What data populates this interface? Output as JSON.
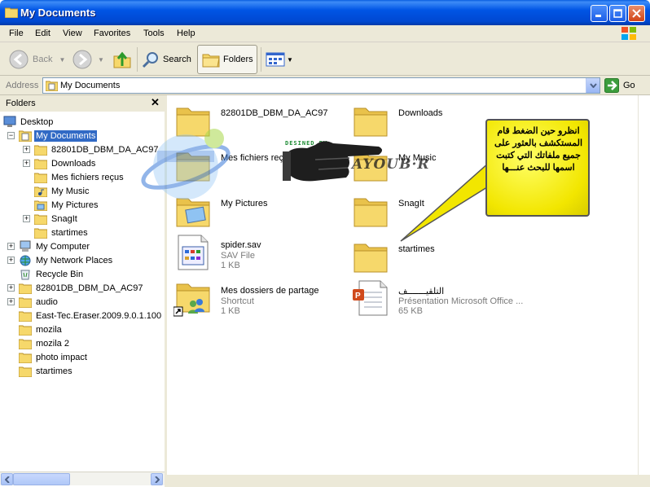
{
  "window": {
    "title": "My Documents"
  },
  "menu": [
    "File",
    "Edit",
    "View",
    "Favorites",
    "Tools",
    "Help"
  ],
  "toolbar": {
    "back": "Back",
    "search": "Search",
    "folders": "Folders"
  },
  "address": {
    "label": "Address",
    "value": "My Documents",
    "go": "Go"
  },
  "folders_pane": {
    "title": "Folders",
    "items": [
      {
        "label": "Desktop"
      },
      {
        "label": "My Documents"
      },
      {
        "label": "82801DB_DBM_DA_AC97"
      },
      {
        "label": "Downloads"
      },
      {
        "label": "Mes fichiers reçus"
      },
      {
        "label": "My Music"
      },
      {
        "label": "My Pictures"
      },
      {
        "label": "SnagIt"
      },
      {
        "label": "startimes"
      },
      {
        "label": "My Computer"
      },
      {
        "label": "My Network Places"
      },
      {
        "label": "Recycle Bin"
      },
      {
        "label": "82801DB_DBM_DA_AC97"
      },
      {
        "label": "audio"
      },
      {
        "label": "East-Tec.Eraser.2009.9.0.1.100"
      },
      {
        "label": "mozila"
      },
      {
        "label": "mozila 2"
      },
      {
        "label": "photo impact"
      },
      {
        "label": "startimes"
      }
    ]
  },
  "content": {
    "items": [
      {
        "name": "82801DB_DBM_DA_AC97"
      },
      {
        "name": "Downloads"
      },
      {
        "name": "Mes fichiers reçus"
      },
      {
        "name": "My Music"
      },
      {
        "name": "My Pictures"
      },
      {
        "name": "SnagIt"
      },
      {
        "name": "spider.sav",
        "type": "SAV File",
        "size": "1 KB"
      },
      {
        "name": "startimes"
      },
      {
        "name": "Mes dossiers de partage",
        "type": "Shortcut",
        "size": "1 KB"
      },
      {
        "name": "التلقيـــــــف",
        "type": "Présentation Microsoft Office ...",
        "size": "65 KB"
      }
    ]
  },
  "overlay": {
    "designed_by": "DESINED BY",
    "signature": "AYOUB·R",
    "callout": "انظرو حين الضغط قام المستكشف بالعثور على جميع ملفاتك التي كتبت اسمها للبحث عنـــها"
  },
  "colors": {
    "title_bar": "#0055e5",
    "selection": "#316ac5",
    "folder": "#f6d86b",
    "callout": "#f2e600"
  }
}
